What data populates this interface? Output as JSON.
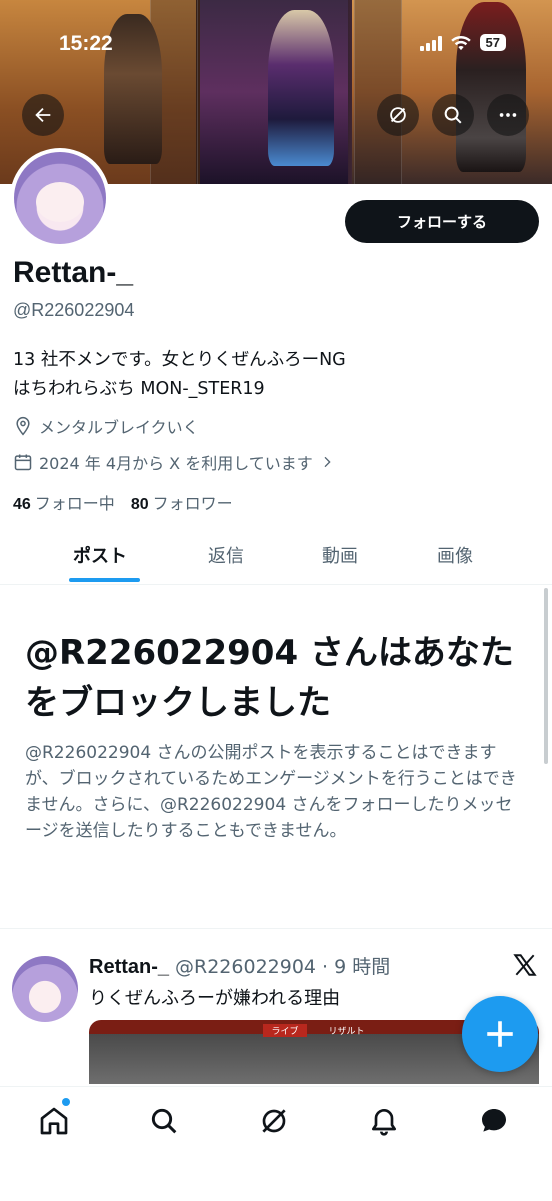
{
  "status_bar": {
    "time": "15:22",
    "battery": "57"
  },
  "profile": {
    "display_name": "Rettan-_",
    "handle": "@R226022904",
    "bio_line1": "13 社不メンです。女とりくぜんふろーNG",
    "bio_line2": "はちわれらぶち MON-_STER19",
    "location": "メンタルブレイクいく",
    "joined": "2024 年 4月から X を利用しています",
    "following_count": "46",
    "following_label": "フォロー中",
    "followers_count": "80",
    "followers_label": "フォロワー",
    "follow_button": "フォローする"
  },
  "tabs": [
    {
      "label": "ポスト"
    },
    {
      "label": "返信"
    },
    {
      "label": "動画"
    },
    {
      "label": "画像"
    }
  ],
  "blocked": {
    "title": "@R226022904 さんはあなたをブロックしました",
    "description": "@R226022904 さんの公開ポストを表示することはできますが、ブロックされているためエンゲージメントを行うことはできません。さらに、@R226022904 さんをフォローしたりメッセージを送信したりすることもできません。"
  },
  "post": {
    "author": "Rettan-_",
    "meta": "@R226022904 · 9 時間",
    "text": "りくぜんふろーが嫌われる理由",
    "media_tabs": [
      "ライブ",
      "リザルト"
    ]
  },
  "icons": {
    "back": "back-arrow-icon",
    "grok": "grok-icon",
    "search": "search-icon",
    "more": "more-icon",
    "compose": "plus-icon",
    "nav": [
      "home-icon",
      "search-icon",
      "grok-icon",
      "bell-icon",
      "message-icon"
    ]
  },
  "colors": {
    "accent": "#1d9bf0",
    "text": "#0f1419",
    "secondary": "#536471"
  }
}
